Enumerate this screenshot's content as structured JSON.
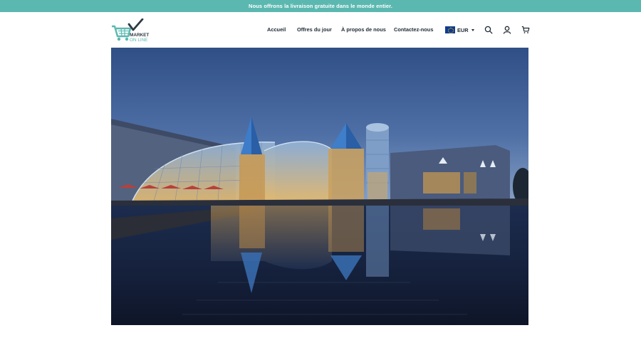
{
  "announcement": {
    "text": "Nous offrons la livraison gratuite dans le monde entier."
  },
  "logo": {
    "line1": "MARKET",
    "line2": "ON LINE",
    "icon": "shopping-cart-check-icon"
  },
  "nav": {
    "items": [
      {
        "label": "Accueil"
      },
      {
        "label": "Offres du jour"
      },
      {
        "label": "À propos de nous"
      },
      {
        "label": "Contactez-nous"
      }
    ]
  },
  "currency": {
    "selected": "EUR",
    "flag_icon": "eu-flag-icon"
  },
  "header_icons": [
    "search-icon",
    "user-icon",
    "cart-icon"
  ],
  "hero": {
    "image": "illuminated glass shopping mall reflected in water at dusk"
  },
  "colors": {
    "accent": "#5bb8b0",
    "text": "#1f2a33",
    "background": "#ffffff"
  }
}
